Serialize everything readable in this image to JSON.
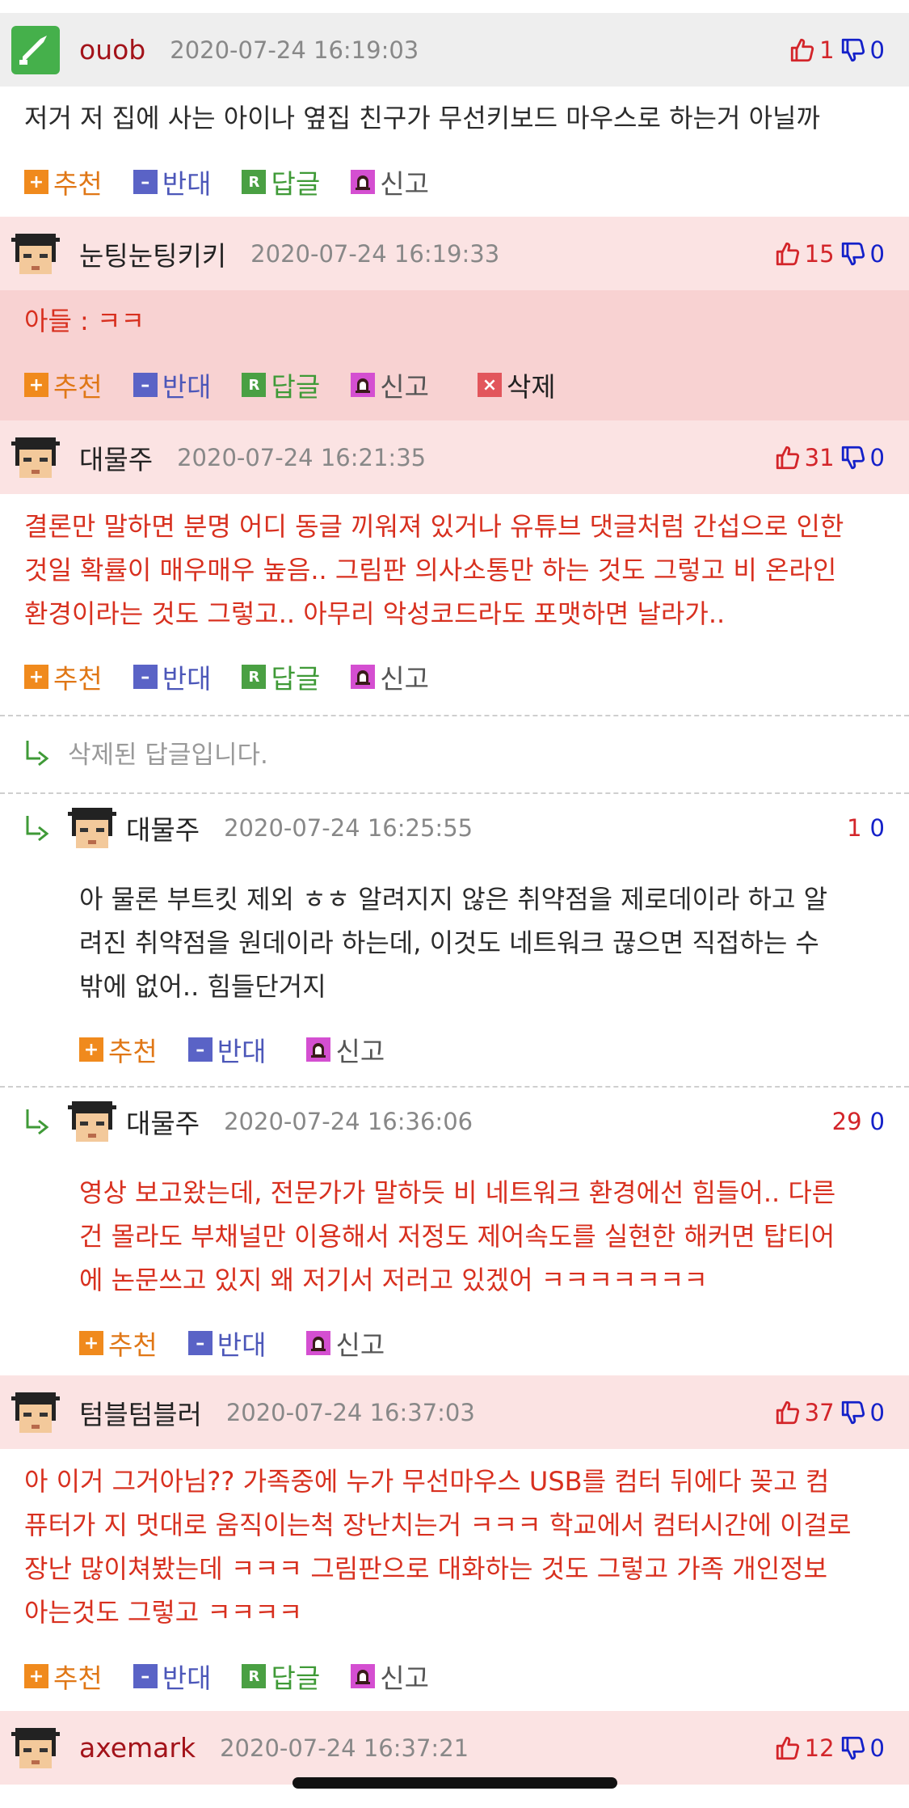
{
  "colors": {
    "upvote": "#d3252a",
    "downvote": "#1421c9",
    "header_pink": "#fbe3e3",
    "body_pink": "#f8d2d2"
  },
  "icons": {
    "up": "thumbs-up-icon",
    "down": "thumbs-down-icon",
    "plus": "plus-icon",
    "minus": "minus-icon",
    "reply": "reply-icon",
    "report": "alarm-bell-icon",
    "delete": "delete-x-icon"
  },
  "actions": {
    "recommend": "추천",
    "oppose": "반대",
    "reply": "답글",
    "report": "신고",
    "delete": "삭제"
  },
  "comments": [
    {
      "nick": "ouob",
      "time": "2020-07-24 16:19:03",
      "up": "1",
      "down": "0",
      "lines": [
        "저거 저 집에 사는 아이나 옆집 친구가 무선키보드 마우스로 하는거 아닐까"
      ]
    },
    {
      "nick": "눈팅눈팅키키",
      "time": "2020-07-24 16:19:33",
      "up": "15",
      "down": "0",
      "lines": [
        "아들 : ㅋㅋ"
      ]
    },
    {
      "nick": "대물주",
      "time": "2020-07-24 16:21:35",
      "up": "31",
      "down": "0",
      "lines": [
        "결론만 말하면 분명 어디 동글 끼워져 있거나 유튜브 댓글처럼 간섭으로 인한",
        "것일 확률이 매우매우 높음.. 그림판 의사소통만 하는 것도 그렇고 비 온라인",
        "환경이라는 것도 그렇고.. 아무리 악성코드라도 포맷하면 날라가.."
      ]
    },
    {
      "nick": "텀블텀블러",
      "time": "2020-07-24 16:37:03",
      "up": "37",
      "down": "0",
      "lines": [
        "아 이거 그거아님?? 가족중에 누가 무선마우스 USB를 컴터 뒤에다 꽂고 컴",
        "퓨터가 지 멋대로 움직이는척 장난치는거 ㅋㅋㅋ 학교에서 컴터시간에 이걸로",
        "장난 많이쳐봤는데 ㅋㅋㅋ 그림판으로 대화하는 것도 그렇고 가족 개인정보",
        "아는것도 그렇고 ㅋㅋㅋㅋ"
      ]
    },
    {
      "nick": "axemark",
      "time": "2020-07-24 16:37:21",
      "up": "12",
      "down": "0"
    }
  ],
  "replies": [
    {
      "deleted_text": "삭제된 답글입니다."
    },
    {
      "nick": "대물주",
      "time": "2020-07-24 16:25:55",
      "up": "1",
      "down": "0",
      "lines": [
        "아 물론 부트킷 제외 ㅎㅎ 알려지지 않은 취약점을 제로데이라 하고 알",
        "려진 취약점을 원데이라 하는데, 이것도 네트워크 끊으면 직접하는 수",
        "밖에 없어.. 힘들단거지"
      ]
    },
    {
      "nick": "대물주",
      "time": "2020-07-24 16:36:06",
      "up": "29",
      "down": "0",
      "lines": [
        "영상 보고왔는데, 전문가가 말하듯 비 네트워크 환경에선 힘들어.. 다른",
        "건 몰라도 부채널만 이용해서 저정도 제어속도를 실현한 해커면 탑티어",
        "에 논문쓰고 있지 왜 저기서 저러고 있겠어 ㅋㅋㅋㅋㅋㅋㅋ"
      ]
    }
  ]
}
